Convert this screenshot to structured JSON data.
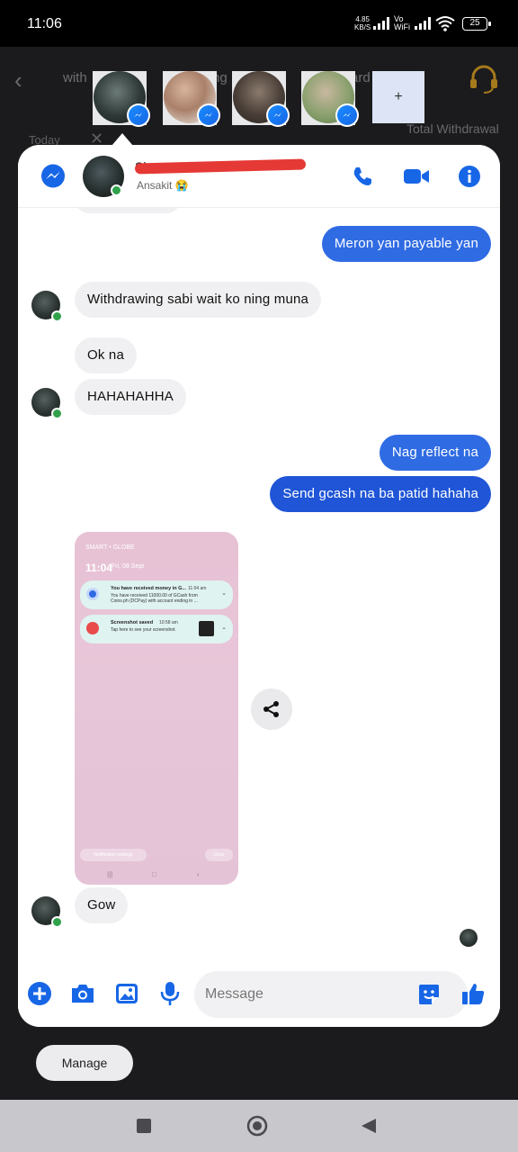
{
  "status": {
    "time": "11:06",
    "net_speed": "4.85",
    "net_unit": "KB/S",
    "vowifi": "Vo WiFi",
    "battery": "25"
  },
  "background": {
    "tab_left": "with",
    "tab_mid": "ng",
    "tab_right": "ard   wards",
    "filter": "Today",
    "total_label": "Total Withdrawal"
  },
  "chat_heads": {
    "add_label": "+"
  },
  "header": {
    "name": "Sh",
    "status": "Ansakit 😭"
  },
  "messages": [
    {
      "from": "me",
      "text": "Meron yan payable yan"
    },
    {
      "from": "them",
      "text": "Withdrawing sabi wait ko ning muna"
    },
    {
      "from": "them",
      "text": "Ok na"
    },
    {
      "from": "them",
      "text": "HAHAHAHHA"
    },
    {
      "from": "me",
      "text": "Nag reflect na"
    },
    {
      "from": "me",
      "text": "Send gcash na ba patid hahaha"
    },
    {
      "from": "them",
      "text": "Gow"
    }
  ],
  "screenshot": {
    "carrier": "SMART • GLOBE",
    "time": "11:04",
    "date": "Fri, 08 Sept",
    "notif1_title": "You have received money in G...",
    "notif1_time": "11:04 am",
    "notif1_body": "You have received 11000.00 of GCash from Coins.ph (DCPay) with account ending in ...",
    "notif2_title": "Screenshot saved",
    "notif2_time": "10:58 am",
    "notif2_body": "Tap here to see your screenshot.",
    "pill_left": "Notification settings",
    "pill_right": "Clear"
  },
  "composer": {
    "placeholder": "Message"
  },
  "manage_label": "Manage",
  "colors": {
    "messenger_blue": "#1766e6",
    "bubble_out": "#2f6be3",
    "online": "#31a24c"
  }
}
